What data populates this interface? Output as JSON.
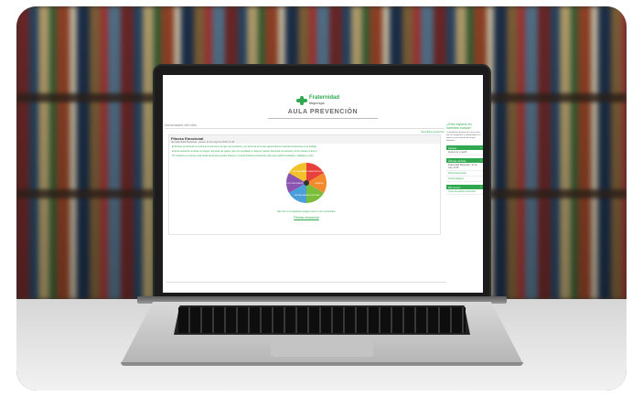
{
  "site": {
    "brand_name": "Fraternidad",
    "brand_sub": "Muprespa",
    "section_title": "AULA PREVENCIÓN"
  },
  "forum": {
    "heading": "Novedades del sitio",
    "subscribe": "Suscribirse a este foro",
    "post_title": "Fitness Emocional",
    "post_meta": "de Fraternidad Muprespa - jueves, 31 de mayo de 2018, 11:35",
    "post_lines": [
      "El Fitness emocional se centra en la forma en la que nos sentimos y en la forma en la que gestionamos nuestras emociones en el trabajo.",
      "El entrenamiento consiste en seguir una serie de pasos, que nos ayudarán a mejorar nuestro bienestar emocional y el de nuestro entorno.",
      "Te invitamos a conocer esta rueda de la que puedes obtener tu propio Fitness emocional, para que puedas evaluarte y trabajar en ello."
    ],
    "wheel_segments": [
      {
        "label": "GESTIONAR EMOCIONES",
        "color": "#e8403a"
      },
      {
        "label": "EMPATIA",
        "color": "#f28a2e"
      },
      {
        "label": "AUTOESTIMA",
        "color": "#7bbd3b"
      },
      {
        "label": "SOCIALIZAR",
        "color": "#4a9fd8"
      },
      {
        "label": "AUTOCONOCIMIENTO",
        "color": "#8a54b0"
      },
      {
        "label": "MOTIVACIÓN",
        "color": "#f3c12b"
      }
    ],
    "caption": "Haz clic en la siguiente imagen para ir a los contenidos:",
    "link": "Fitness emocional"
  },
  "sidebar": {
    "promo_title": "¿Eres experto en nuestros cursos?",
    "promo_body": "La plataforma dispone de cursos para que tus empleados y colaboradores se formen en prevención de riesgos laborales.",
    "blocks": [
      {
        "title": "Ajustes",
        "items": [
          "Ajustes de mi perfil"
        ]
      },
      {
        "title": "Últimas noticias",
        "items": [
          "Fraternidad Muprespa - 31 de may, 11:35",
          "Fitness Emocional",
          "Temas antiguos..."
        ]
      },
      {
        "title": "Mis cursos",
        "items": [
          "Curso de gestión emocional"
        ]
      }
    ]
  },
  "colors": {
    "brand_green": "#2fa84f"
  }
}
